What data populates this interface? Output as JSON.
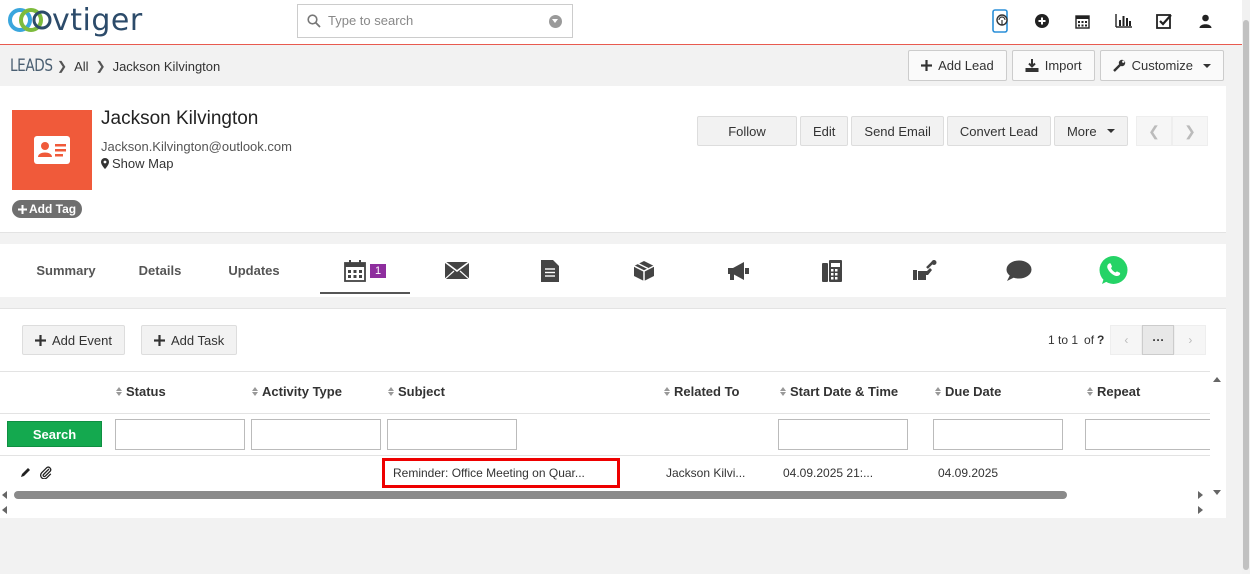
{
  "app": {
    "logo_text": "vtiger"
  },
  "search": {
    "placeholder": "Type to search"
  },
  "top_icons": [
    "remote-support-icon",
    "plus-circle-icon",
    "calendar-icon",
    "bar-chart-icon",
    "checkbox-icon",
    "user-icon"
  ],
  "breadcrumb": {
    "module": "LEADS",
    "filter": "All",
    "record": "Jackson Kilvington"
  },
  "header_actions": {
    "add_lead": "Add Lead",
    "import": "Import",
    "customize": "Customize"
  },
  "record": {
    "name": "Jackson Kilvington",
    "email": "Jackson.Kilvington@outlook.com",
    "show_map": "Show Map",
    "add_tag": "Add Tag"
  },
  "record_actions": {
    "follow": "Follow",
    "edit": "Edit",
    "send_email": "Send Email",
    "convert_lead": "Convert Lead",
    "more": "More"
  },
  "tabs": {
    "summary": "Summary",
    "details": "Details",
    "updates": "Updates",
    "activities_count": "1",
    "icon_tabs": [
      "envelope-icon",
      "document-icon",
      "box-icon",
      "megaphone-icon",
      "phone-icon",
      "wrench-hand-icon",
      "chat-icon",
      "whatsapp-icon"
    ]
  },
  "activities": {
    "add_event": "Add Event",
    "add_task": "Add Task",
    "pager_range": "1 to 1",
    "pager_of": "of",
    "pager_total": "?",
    "pager_more": "···",
    "columns": [
      "Status",
      "Activity Type",
      "Subject",
      "Related To",
      "Start Date & Time",
      "Due Date",
      "Repeat"
    ],
    "search_label": "Search",
    "rows": [
      {
        "status": "",
        "activity_type": "",
        "subject": "Reminder: Office Meeting on Quar...",
        "related_to": "Jackson Kilvi...",
        "start": "04.09.2025 21:...",
        "due": "04.09.2025",
        "repeat": ""
      }
    ]
  },
  "colors": {
    "accent_red": "#e85a4f",
    "lead_icon_bg": "#f05a3a",
    "search_btn": "#14a94f",
    "badge": "#8e2e9e",
    "highlight": "#ee0000"
  }
}
